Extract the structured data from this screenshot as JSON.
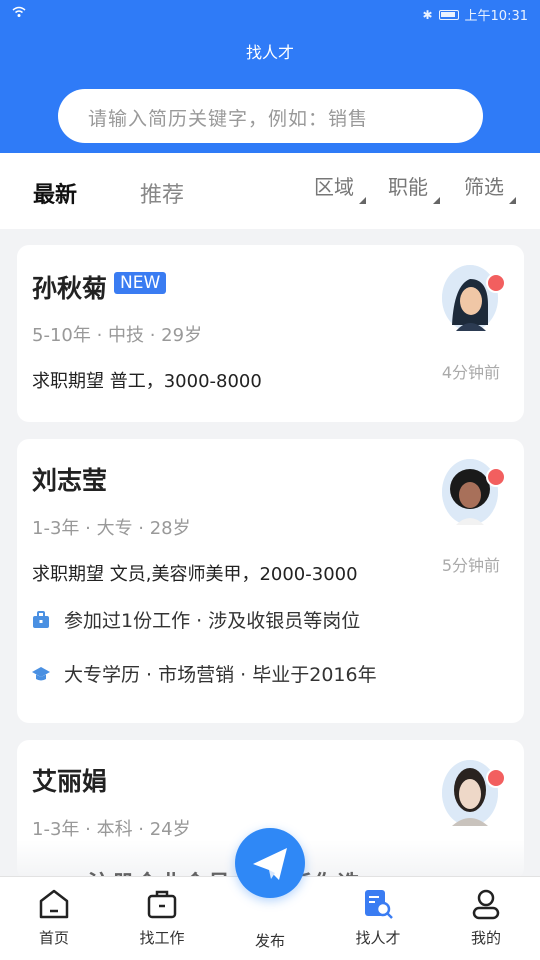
{
  "status": {
    "time": "上午10:31"
  },
  "header": {
    "title": "找人才",
    "search_placeholder": "请输入简历关键字，例如：销售"
  },
  "tabs": {
    "latest": "最新",
    "recommend": "推荐"
  },
  "filters": {
    "region": "区域",
    "function": "职能",
    "filter": "筛选"
  },
  "cards": [
    {
      "name": "孙秋菊",
      "badge": "NEW",
      "meta": "5-10年 · 中技 · 29岁",
      "expect": "求职期望 普工，3000-8000",
      "time": "4分钟前"
    },
    {
      "name": "刘志莹",
      "meta": "1-3年 · 大专 · 28岁",
      "expect": "求职期望 文员,美容师美甲，2000-3000",
      "time": "5分钟前",
      "work": "参加过1份工作 · 涉及收银员等岗位",
      "edu": "大专学历 · 市场营销 · 毕业于2016年"
    },
    {
      "name": "艾丽娟",
      "meta": "1-3年 · 本科 · 24岁"
    }
  ],
  "obscured_banner": "注册企业会员 简历任你选",
  "nav": {
    "home": "首页",
    "jobs": "找工作",
    "publish": "发布",
    "talent": "找人才",
    "mine": "我的"
  },
  "colors": {
    "brand": "#2f7bf7",
    "badge": "#3a7cf2",
    "dot": "#f25f5f"
  }
}
